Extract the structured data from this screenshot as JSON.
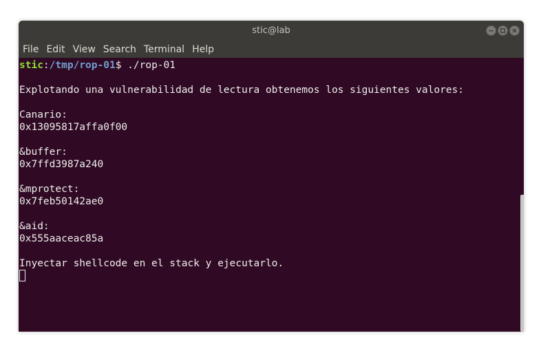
{
  "window": {
    "title": "stic@lab",
    "buttons": [
      "minimize-icon",
      "maximize-icon",
      "close-icon"
    ]
  },
  "menu": {
    "items": [
      "File",
      "Edit",
      "View",
      "Search",
      "Terminal",
      "Help"
    ]
  },
  "prompt": {
    "user": "stic",
    "colon": ":",
    "path": "/tmp/rop-01",
    "symbol": "$ ",
    "command": "./rop-01"
  },
  "output": {
    "intro": "Explotando una vulnerabilidad de lectura obtenemos los siguientes valores:",
    "canario_label": "Canario:",
    "canario_value": "0x13095817affa0f00",
    "buffer_label": "&buffer:",
    "buffer_value": "0x7ffd3987a240",
    "mprotect_label": "&mprotect:",
    "mprotect_value": "0x7feb50142ae0",
    "aid_label": "&aid:",
    "aid_value": "0x555aaceac85a",
    "final": "Inyectar shellcode en el stack y ejecutarlo."
  },
  "colors": {
    "terminal_bg": "#300a24",
    "titlebar_bg": "#3c3b37",
    "prompt_user": "#8ae234",
    "prompt_path": "#729fcf",
    "text": "#eeeeec"
  }
}
